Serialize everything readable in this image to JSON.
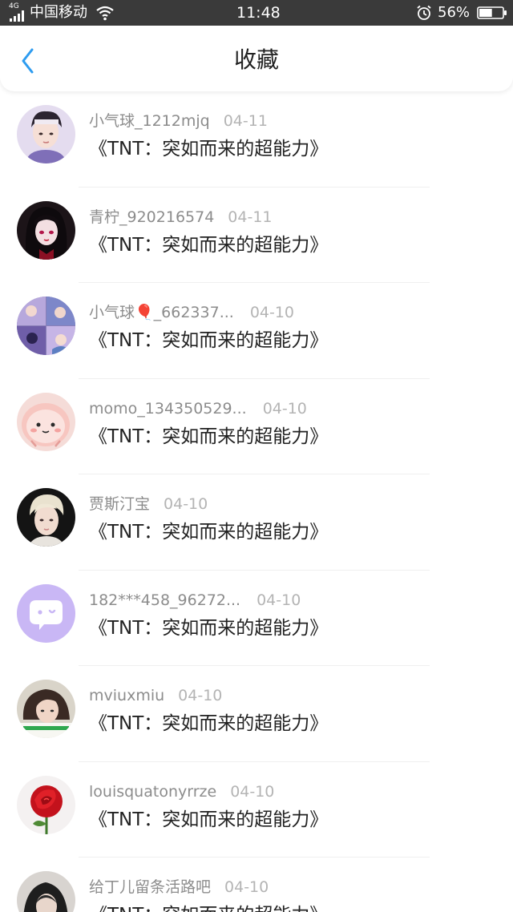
{
  "status_bar": {
    "network": "4G",
    "carrier": "中国移动",
    "time": "11:48",
    "battery": "56%",
    "battery_level": 0.56
  },
  "header": {
    "title": "收藏",
    "accent_color": "#2e9cf0"
  },
  "favorites": [
    {
      "username": "小气球_1212mjq",
      "date": "04-11",
      "title": "《TNT：突如而来的超能力》",
      "avatar": "boy-idol-photo"
    },
    {
      "username": "青柠_920216574",
      "date": "04-11",
      "title": "《TNT：突如而来的超能力》",
      "avatar": "anime-girl-photo"
    },
    {
      "username": "小气球🎈_662337...",
      "date": "04-10",
      "title": "《TNT：突如而来的超能力》",
      "avatar": "collage-photo"
    },
    {
      "username": "momo_134350529...",
      "date": "04-10",
      "title": "《TNT：突如而来的超能力》",
      "avatar": "cartoon-face"
    },
    {
      "username": "贾斯汀宝",
      "date": "04-10",
      "title": "《TNT：突如而来的超能力》",
      "avatar": "blond-boy-photo"
    },
    {
      "username": "182***458_96272...",
      "date": "04-10",
      "title": "《TNT：突如而来的超能力》",
      "avatar": "default-chat-avatar"
    },
    {
      "username": "mviuxmiu",
      "date": "04-10",
      "title": "《TNT：突如而来的超能力》",
      "avatar": "girl-photo"
    },
    {
      "username": "louisquatonyrrze",
      "date": "04-10",
      "title": "《TNT：突如而来的超能力》",
      "avatar": "red-rose-photo"
    },
    {
      "username": "给丁儿留条活路吧",
      "date": "04-10",
      "title": "《TNT：突如而来的超能力》",
      "avatar": "hooded-figure-photo"
    }
  ]
}
